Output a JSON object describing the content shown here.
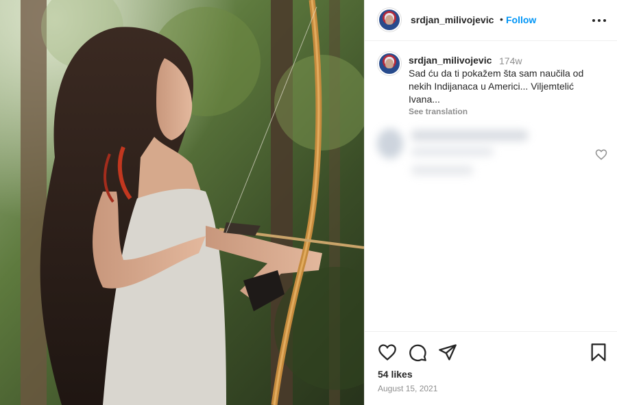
{
  "post": {
    "username": "srdjan_milivojevic",
    "dot": "•",
    "follow_label": "Follow",
    "caption_time": "174w",
    "caption_text": "Sad ću da ti pokažem šta sam naučila od nekih Indijanaca u Americi... Viljemtelić Ivana...",
    "see_translation": "See translation",
    "likes": "54 likes",
    "date": "August 15, 2021"
  },
  "icons": {
    "more": "more-options-icon",
    "like": "heart-icon",
    "comment": "comment-icon",
    "share": "share-icon",
    "save": "bookmark-icon",
    "comment_like": "heart-outline-icon"
  },
  "colors": {
    "link": "#0095f6",
    "text": "#262626",
    "muted": "#8e8e8e",
    "border": "#efefef"
  }
}
